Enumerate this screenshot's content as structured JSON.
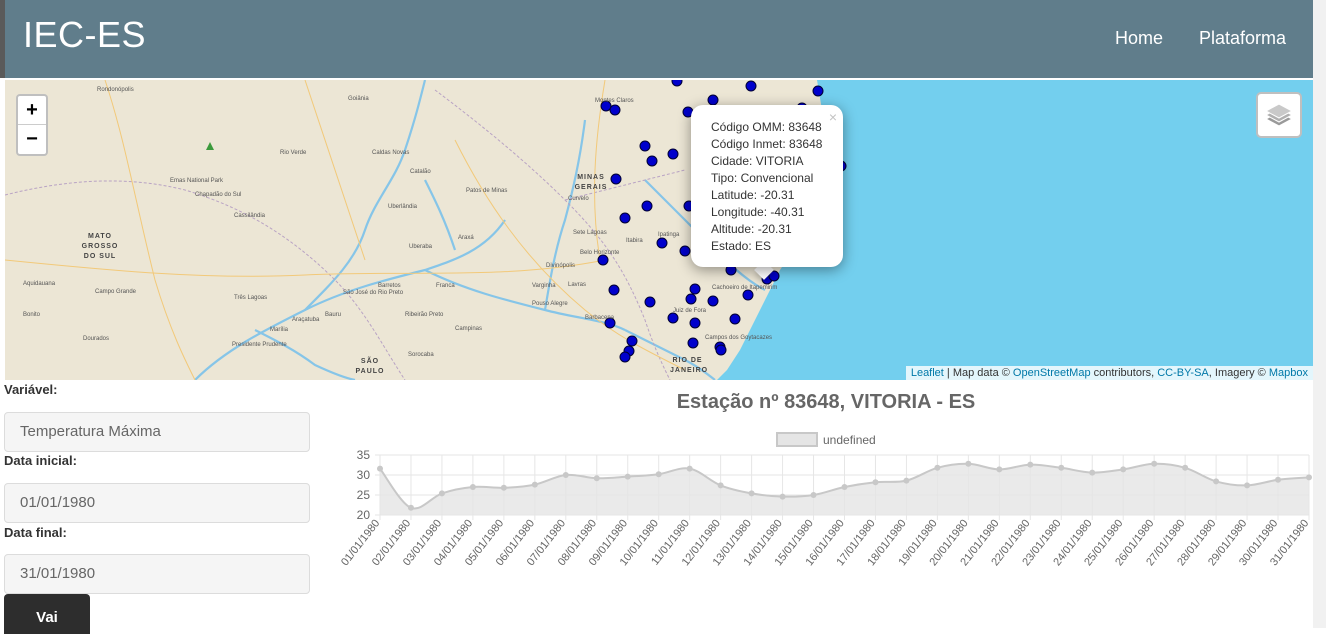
{
  "navbar": {
    "brand": "IEC-ES",
    "links": [
      "Home",
      "Plataforma"
    ]
  },
  "map": {
    "zoom_in": "+",
    "zoom_out": "−",
    "labels": {
      "goiania": "Goiânia",
      "rondonopolis": "Rondonópolis",
      "rio_verde": "Rio Verde",
      "caldas_novas": "Caldas Novas",
      "catalao": "Catalão",
      "emas": "Emas National Park",
      "chapadao": "Chapadão do Sul",
      "cassilandia": "Cassilândia",
      "uberlandia": "Uberlândia",
      "patos": "Patos de Minas",
      "uberaba": "Uberaba",
      "araxa": "Araxá",
      "franca": "Franca",
      "ribeirao": "Ribeirão Preto",
      "campinas": "Campinas",
      "sorocaba": "Sorocaba",
      "bauru": "Bauru",
      "marilia": "Marília",
      "campo_grande": "Campo Grande",
      "dourados": "Dourados",
      "bonito": "Bonito",
      "aquidauana": "Aquidauana",
      "tres_lagoas": "Três Lagoas",
      "aracatuba": "Araçatuba",
      "presidente": "Presidente Prudente",
      "sao_jose": "São José do Rio Preto",
      "barretos": "Barretos",
      "belo_horizonte": "Belo Horizonte",
      "divinopolis": "Divinópolis",
      "sete_lagoas": "Sete Lagoas",
      "montes_claros": "Montes Claros",
      "curvelo": "Curvelo",
      "ipatinga": "Ipatinga",
      "itabira": "Itabira",
      "juiz_fora": "Juiz de Fora",
      "barbacena": "Barbacena",
      "campos": "Campos dos Goytacazes",
      "cachoeiro": "Cachoeiro de Itapemirim",
      "pouso_alegre": "Pouso Alegre",
      "varginha": "Varginha",
      "lavras": "Lavras",
      "ms_state": "MATO GROSSO DO SUL",
      "mg_state": "MINAS GERAIS",
      "sp_state": "SÃO PAULO",
      "rj_state": "RIO DE JANEIRO"
    },
    "popup": {
      "close": "×",
      "lines": [
        "Código OMM: 83648",
        "Código Inmet: 83648",
        "Cidade: VITORIA",
        "Tipo: Convencional",
        "Latitude: -20.31",
        "Longitude: -40.31",
        "Altitude: -20.31",
        "Estado: ES"
      ]
    },
    "attribution": {
      "leaflet": "Leaflet",
      "sep1": " | Map data © ",
      "osm": "OpenStreetMap",
      "sep2": " contributors, ",
      "license": "CC-BY-SA",
      "sep3": ", Imagery © ",
      "mapbox": "Mapbox"
    },
    "colors": {
      "land": "#ece6d5",
      "water": "#73cfee",
      "station": "#0000cc"
    }
  },
  "form": {
    "variable_label": "Variável:",
    "variable_value": "Temperatura Máxima",
    "start_label": "Data inicial:",
    "start_value": "01/01/1980",
    "end_label": "Data final:",
    "end_value": "31/01/1980",
    "submit": "Vai"
  },
  "chart_title": "Estação nº 83648, VITORIA - ES",
  "chart_data": {
    "type": "area",
    "legend": "undefined",
    "categories": [
      "01/01/1980",
      "02/01/1980",
      "03/01/1980",
      "04/01/1980",
      "05/01/1980",
      "06/01/1980",
      "07/01/1980",
      "08/01/1980",
      "09/01/1980",
      "10/01/1980",
      "11/01/1980",
      "12/01/1980",
      "13/01/1980",
      "14/01/1980",
      "15/01/1980",
      "16/01/1980",
      "17/01/1980",
      "18/01/1980",
      "19/01/1980",
      "20/01/1980",
      "21/01/1980",
      "22/01/1980",
      "23/01/1980",
      "24/01/1980",
      "25/01/1980",
      "26/01/1980",
      "27/01/1980",
      "28/01/1980",
      "29/01/1980",
      "30/01/1980",
      "31/01/1980"
    ],
    "values": [
      31.6,
      21.8,
      25.4,
      27.0,
      26.8,
      27.6,
      30.0,
      29.2,
      29.6,
      30.2,
      31.6,
      27.4,
      25.4,
      24.6,
      25.0,
      27.0,
      28.2,
      28.6,
      31.8,
      32.8,
      31.4,
      32.6,
      31.8,
      30.6,
      31.4,
      32.8,
      31.8,
      28.4,
      27.4,
      28.8,
      29.4
    ],
    "yticks": [
      20,
      25,
      30,
      35
    ],
    "ylim": [
      20,
      35
    ],
    "colors": {
      "line": "#c8c8c8",
      "fill": "#e5e5e5",
      "point": "#c8c8c8"
    }
  }
}
